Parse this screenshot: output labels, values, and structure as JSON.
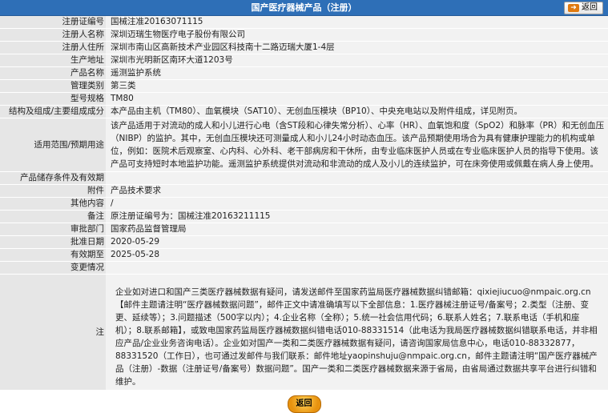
{
  "header": {
    "title": "国产医疗器械产品（注册）",
    "back_label": "返回"
  },
  "rows": [
    {
      "label": "注册证编号",
      "value": "国械注准20163071115"
    },
    {
      "label": "注册人名称",
      "value": "深圳迈瑞生物医疗电子股份有限公司"
    },
    {
      "label": "注册人住所",
      "value": "深圳市南山区高新技术产业园区科技南十二路迈瑞大厦1-4层"
    },
    {
      "label": "生产地址",
      "value": "深圳市光明新区南环大道1203号"
    },
    {
      "label": "产品名称",
      "value": "遥测监护系统"
    },
    {
      "label": "管理类别",
      "value": "第三类"
    },
    {
      "label": "型号规格",
      "value": "TM80"
    },
    {
      "label": "结构及组成/主要组成成分",
      "value": "本产品由主机（TM80）、血氧模块（SAT10）、无创血压模块（BP10）、中央充电站以及附件组成，详见附页。"
    },
    {
      "label": "适用范围/预期用途",
      "value": "该产品适用于对流动的成人和小儿进行心电（含ST段和心律失常分析）、心率（HR）、血氧饱和度（SpO2）和脉率（PR）和无创血压（NIBP）的监护。其中，无创血压模块还可测量成人和小儿24小时动态血压。该产品预期使用场合为具有健康护理能力的机构或单位，例如：医院术后观察室、心内科、心外科、老干部病房和干休所，由专业临床医护人员或在专业临床医护人员的指导下使用。该产品可支持短时本地监护功能。遥测监护系统提供对流动和非流动的成人及小儿的连续监护，可在床旁使用或佩戴在病人身上使用。"
    },
    {
      "label": "产品储存条件及有效期",
      "value": ""
    },
    {
      "label": "附件",
      "value": "产品技术要求"
    },
    {
      "label": "其他内容",
      "value": "/"
    },
    {
      "label": "备注",
      "value": "原注册证编号为：国械注准20163211115"
    },
    {
      "label": "审批部门",
      "value": "国家药品监督管理局"
    },
    {
      "label": "批准日期",
      "value": "2020-05-29"
    },
    {
      "label": "有效期至",
      "value": "2025-05-28"
    },
    {
      "label": "变更情况",
      "value": ""
    }
  ],
  "note": {
    "label": "注",
    "text": "企业如对进口和国产三类医疗器械数据有疑问，请发送邮件至国家药监局医疗器械数据纠错邮箱：qixiejiucuo@nmpaic.org.cn【邮件主题请注明“医疗器械数据问题”，邮件正文中请准确填写以下全部信息：1.医疗器械注册证号/备案号；2.类型（注册、变更、延续等）；3.问题描述（500字以内）；4.企业名称（全称）；5.统一社会信用代码；6.联系人姓名；7.联系电话（手机和座机）；8.联系邮箱】，或致电国家药监局医疗器械数据纠错电话010-88331514（此电话为我局医疗器械数据纠错联系电话，并非相应产品/企业业务咨询电话）。企业如对国产一类和二类医疗器械数据有疑问，请咨询国家局信息中心，电话010-88332877，88331520（工作日），也可通过发邮件与我们联系：邮件地址yaopinshuju@nmpaic.org.cn，邮件主题请注明“国产医疗器械产品（注册）-数据（注册证号/备案号）数据问题”。国产一类和二类医疗器械数据来源于省局，由省局通过数据共享平台进行纠错和维护。"
  },
  "footer": {
    "back_label": "返回"
  }
}
